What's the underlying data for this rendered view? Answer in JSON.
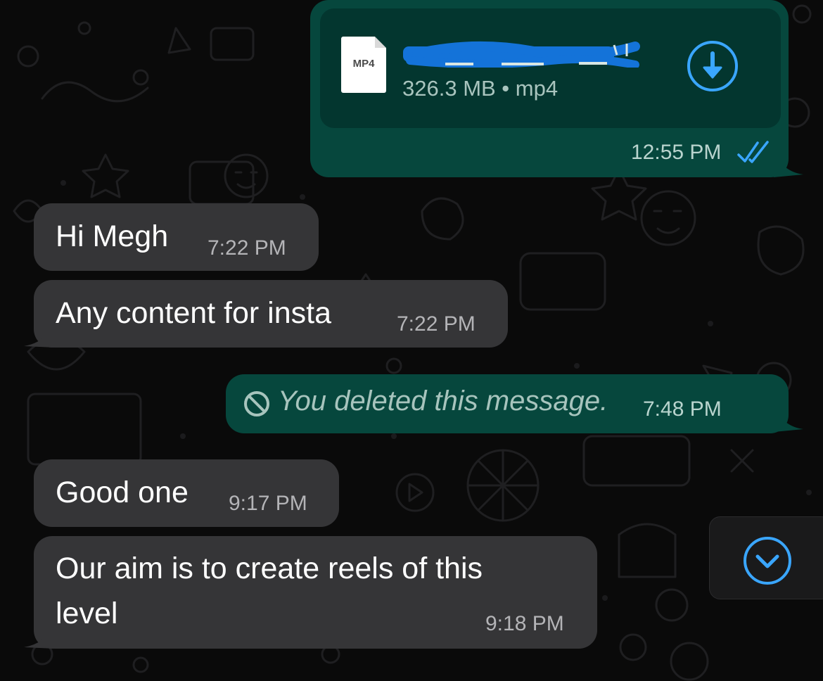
{
  "colors": {
    "incoming_bubble": "#353537",
    "outgoing_bubble": "#06473d",
    "accent_blue": "#3aa6ff",
    "background": "#0a0a0a"
  },
  "messages": {
    "file": {
      "file_type_badge": "MP4",
      "file_meta": "326.3 MB • mp4",
      "time": "12:55 PM",
      "status_icon": "double-check-read-icon",
      "action_icon": "download-circle-icon",
      "filename_redacted": true
    },
    "hi": {
      "text": "Hi Megh",
      "time": "7:22 PM"
    },
    "content": {
      "text": "Any content for insta",
      "time": "7:22 PM"
    },
    "deleted": {
      "text": "You deleted this message.",
      "time": "7:48 PM",
      "icon": "prohibited-icon"
    },
    "good": {
      "text": "Good one",
      "time": "9:17 PM"
    },
    "aim": {
      "line1": "Our aim is to create reels of this",
      "line2": "level",
      "time": "9:18 PM"
    }
  },
  "scroll_button": {
    "icon": "chevron-down-circle-icon"
  }
}
